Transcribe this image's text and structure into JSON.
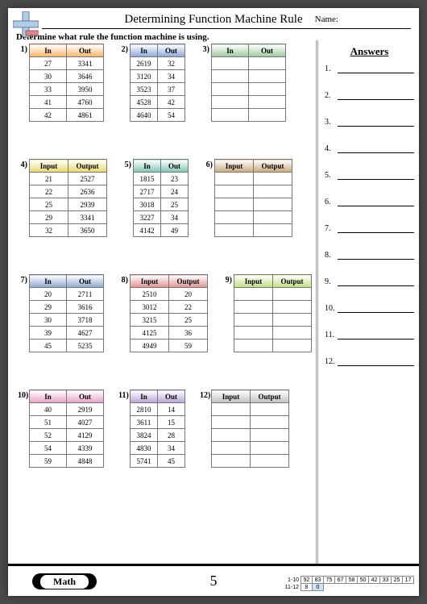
{
  "title": "Determining Function Machine Rule",
  "name_label": "Name:",
  "instruction": "Determine what rule the function machine is using.",
  "answers_title": "Answers",
  "answer_count": 12,
  "footer": {
    "math_label": "Math",
    "page_number": "5"
  },
  "score_strip": {
    "row1_label": "1-10",
    "row1": [
      "92",
      "83",
      "75",
      "67",
      "58",
      "50",
      "42",
      "33",
      "25",
      "17"
    ],
    "row2_label": "11-12",
    "row2": [
      "8",
      "0"
    ]
  },
  "tables": [
    {
      "num": "1)",
      "grad": "g-orange",
      "cls": "wide",
      "headers": [
        "In",
        "Out"
      ],
      "rows": [
        [
          "27",
          "3341"
        ],
        [
          "30",
          "3646"
        ],
        [
          "33",
          "3950"
        ],
        [
          "41",
          "4760"
        ],
        [
          "42",
          "4861"
        ]
      ]
    },
    {
      "num": "2)",
      "grad": "g-blue",
      "cls": "narrow",
      "headers": [
        "In",
        "Out"
      ],
      "rows": [
        [
          "2619",
          "32"
        ],
        [
          "3120",
          "34"
        ],
        [
          "3523",
          "37"
        ],
        [
          "4528",
          "42"
        ],
        [
          "4640",
          "54"
        ]
      ]
    },
    {
      "num": "3)",
      "grad": "g-green",
      "cls": "wide",
      "headers": [
        "In",
        "Out"
      ],
      "rows": [
        [
          "",
          ""
        ],
        [
          "",
          ""
        ],
        [
          "",
          ""
        ],
        [
          "",
          ""
        ],
        [
          "",
          ""
        ]
      ]
    },
    {
      "num": "4)",
      "grad": "g-yellow",
      "cls": "wide2",
      "headers": [
        "Input",
        "Output"
      ],
      "rows": [
        [
          "21",
          "2527"
        ],
        [
          "22",
          "2636"
        ],
        [
          "25",
          "2939"
        ],
        [
          "29",
          "3341"
        ],
        [
          "32",
          "3650"
        ]
      ]
    },
    {
      "num": "5)",
      "grad": "g-teal",
      "cls": "narrow",
      "headers": [
        "In",
        "Out"
      ],
      "rows": [
        [
          "1815",
          "23"
        ],
        [
          "2717",
          "24"
        ],
        [
          "3018",
          "25"
        ],
        [
          "3227",
          "34"
        ],
        [
          "4142",
          "49"
        ]
      ]
    },
    {
      "num": "6)",
      "grad": "g-brown",
      "cls": "wide2",
      "headers": [
        "Input",
        "Output"
      ],
      "rows": [
        [
          "",
          ""
        ],
        [
          "",
          ""
        ],
        [
          "",
          ""
        ],
        [
          "",
          ""
        ],
        [
          "",
          ""
        ]
      ]
    },
    {
      "num": "7)",
      "grad": "g-navy",
      "cls": "wide",
      "headers": [
        "In",
        "Out"
      ],
      "rows": [
        [
          "20",
          "2711"
        ],
        [
          "29",
          "3616"
        ],
        [
          "30",
          "3718"
        ],
        [
          "39",
          "4627"
        ],
        [
          "45",
          "5235"
        ]
      ]
    },
    {
      "num": "8)",
      "grad": "g-red",
      "cls": "wide2",
      "headers": [
        "Input",
        "Output"
      ],
      "rows": [
        [
          "2510",
          "20"
        ],
        [
          "3012",
          "22"
        ],
        [
          "3215",
          "25"
        ],
        [
          "4125",
          "36"
        ],
        [
          "4949",
          "59"
        ]
      ]
    },
    {
      "num": "9)",
      "grad": "g-lime",
      "cls": "wide2",
      "headers": [
        "Input",
        "Output"
      ],
      "rows": [
        [
          "",
          ""
        ],
        [
          "",
          ""
        ],
        [
          "",
          ""
        ],
        [
          "",
          ""
        ],
        [
          "",
          ""
        ]
      ]
    },
    {
      "num": "10)",
      "grad": "g-pink",
      "cls": "wide",
      "headers": [
        "In",
        "Out"
      ],
      "rows": [
        [
          "40",
          "2919"
        ],
        [
          "51",
          "4027"
        ],
        [
          "52",
          "4129"
        ],
        [
          "54",
          "4339"
        ],
        [
          "59",
          "4848"
        ]
      ]
    },
    {
      "num": "11)",
      "grad": "g-purple",
      "cls": "narrow",
      "headers": [
        "In",
        "Out"
      ],
      "rows": [
        [
          "2810",
          "14"
        ],
        [
          "3611",
          "15"
        ],
        [
          "3824",
          "28"
        ],
        [
          "4830",
          "34"
        ],
        [
          "5741",
          "45"
        ]
      ]
    },
    {
      "num": "12)",
      "grad": "g-gray",
      "cls": "wide2",
      "headers": [
        "Input",
        "Output"
      ],
      "rows": [
        [
          "",
          ""
        ],
        [
          "",
          ""
        ],
        [
          "",
          ""
        ],
        [
          "",
          ""
        ],
        [
          "",
          ""
        ]
      ]
    }
  ]
}
